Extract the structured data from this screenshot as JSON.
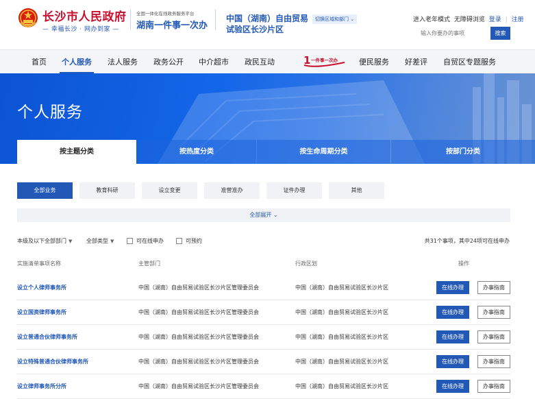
{
  "header": {
    "site_name": "长沙市人民政府",
    "slogan": "— 幸福长沙 · 网办到家 —",
    "platform_sub": "全国一体化在线政务服务平台",
    "platform_main": "湖南一件事一次办",
    "region_name": "中国（湖南）自由贸易试验区长沙片区",
    "switch_label": "切换区域和部门 ⌄",
    "links": {
      "elder_mode": "进入老年模式",
      "accessible": "无障碍浏览",
      "login": "登录",
      "separator": "|",
      "register": "注册"
    },
    "search_placeholder": "输入你要办的事项",
    "search_button": "搜索"
  },
  "nav": {
    "items": [
      "首页",
      "个人服务",
      "法人服务",
      "政务公开",
      "中介超市",
      "政民互动",
      "便民服务",
      "好差评",
      "自贸区专题服务"
    ],
    "logo_text": "一件事一次办",
    "active_index": 1
  },
  "banner": {
    "title": "个人服务"
  },
  "tabs": [
    "按主题分类",
    "按热度分类",
    "按生命周期分类",
    "按部门分类"
  ],
  "chips": [
    "全部业务",
    "教育科研",
    "设立变更",
    "准营准办",
    "证件办理",
    "其他"
  ],
  "expand_label": "全部展开 ⌄",
  "filters": {
    "level": "本级及以下全部部门",
    "type": "全部类型",
    "online": "可在线申办",
    "reserve": "可预约",
    "count_text": "共31个事项，其中24项可在线申办"
  },
  "table": {
    "headers": [
      "实施清单事项名称",
      "主管部门",
      "行政区划",
      "操作"
    ],
    "online_label": "在线办理",
    "guide_label": "办事指南",
    "rows": [
      {
        "name": "设立个人律师事务所",
        "dept": "中国（湖南）自由贸易试验区长沙片区管理委员会",
        "area": "中国（湖南）自由贸易试验区长沙片区"
      },
      {
        "name": "设立国资律师事务所",
        "dept": "中国（湖南）自由贸易试验区长沙片区管理委员会",
        "area": "中国（湖南）自由贸易试验区长沙片区"
      },
      {
        "name": "设立普通合伙律师事务所",
        "dept": "中国（湖南）自由贸易试验区长沙片区管理委员会",
        "area": "中国（湖南）自由贸易试验区长沙片区"
      },
      {
        "name": "设立特殊普通合伙律师事务所",
        "dept": "中国（湖南）自由贸易试验区长沙片区管理委员会",
        "area": "中国（湖南）自由贸易试验区长沙片区"
      },
      {
        "name": "设立律师事务所分所",
        "dept": "中国（湖南）自由贸易试验区长沙片区管理委员会",
        "area": "中国（湖南）自由贸易试验区长沙片区"
      }
    ]
  },
  "colors": {
    "primary": "#2359b6",
    "brand_red": "#c8102e",
    "banner_blue": "#1466e8"
  }
}
